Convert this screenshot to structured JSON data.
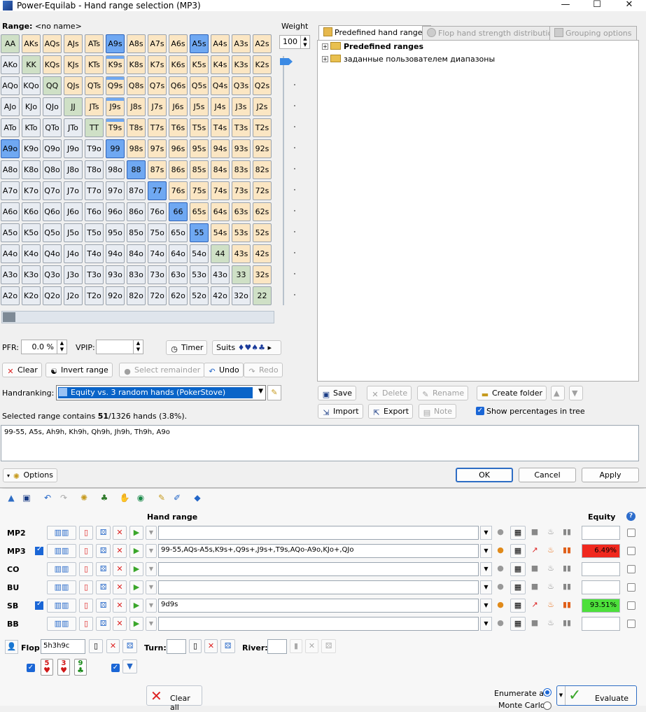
{
  "window": {
    "title": "Power-Equilab - Hand range selection (MP3)"
  },
  "range": {
    "label": "Range:",
    "name": "<no name>"
  },
  "grid": {
    "cells": [
      "AA",
      "AKs",
      "AQs",
      "AJs",
      "ATs",
      "A9s",
      "A8s",
      "A7s",
      "A6s",
      "A5s",
      "A4s",
      "A3s",
      "A2s",
      "AKo",
      "KK",
      "KQs",
      "KJs",
      "KTs",
      "K9s",
      "K8s",
      "K7s",
      "K6s",
      "K5s",
      "K4s",
      "K3s",
      "K2s",
      "AQo",
      "KQo",
      "QQ",
      "QJs",
      "QTs",
      "Q9s",
      "Q8s",
      "Q7s",
      "Q6s",
      "Q5s",
      "Q4s",
      "Q3s",
      "Q2s",
      "AJo",
      "KJo",
      "QJo",
      "JJ",
      "JTs",
      "J9s",
      "J8s",
      "J7s",
      "J6s",
      "J5s",
      "J4s",
      "J3s",
      "J2s",
      "ATo",
      "KTo",
      "QTo",
      "JTo",
      "TT",
      "T9s",
      "T8s",
      "T7s",
      "T6s",
      "T5s",
      "T4s",
      "T3s",
      "T2s",
      "A9o",
      "K9o",
      "Q9o",
      "J9o",
      "T9o",
      "99",
      "98s",
      "97s",
      "96s",
      "95s",
      "94s",
      "93s",
      "92s",
      "A8o",
      "K8o",
      "Q8o",
      "J8o",
      "T8o",
      "98o",
      "88",
      "87s",
      "86s",
      "85s",
      "84s",
      "83s",
      "82s",
      "A7o",
      "K7o",
      "Q7o",
      "J7o",
      "T7o",
      "97o",
      "87o",
      "77",
      "76s",
      "75s",
      "74s",
      "73s",
      "72s",
      "A6o",
      "K6o",
      "Q6o",
      "J6o",
      "T6o",
      "96o",
      "86o",
      "76o",
      "66",
      "65s",
      "64s",
      "63s",
      "62s",
      "A5o",
      "K5o",
      "Q5o",
      "J5o",
      "T5o",
      "95o",
      "85o",
      "75o",
      "65o",
      "55",
      "54s",
      "53s",
      "52s",
      "A4o",
      "K4o",
      "Q4o",
      "J4o",
      "T4o",
      "94o",
      "84o",
      "74o",
      "64o",
      "54o",
      "44",
      "43s",
      "42s",
      "A3o",
      "K3o",
      "Q3o",
      "J3o",
      "T3o",
      "93o",
      "83o",
      "73o",
      "63o",
      "53o",
      "43o",
      "33",
      "32s",
      "A2o",
      "K2o",
      "Q2o",
      "J2o",
      "T2o",
      "92o",
      "82o",
      "72o",
      "62o",
      "52o",
      "42o",
      "32o",
      "22"
    ],
    "selected": [
      "A9s",
      "A5s",
      "99",
      "88",
      "77",
      "66",
      "55",
      "A9o"
    ],
    "partial": [
      "K9s",
      "Q9s",
      "J9s",
      "T9s"
    ]
  },
  "weight": {
    "label": "Weight",
    "value": "100"
  },
  "tabs": [
    {
      "label": "Predefined hand ranges",
      "active": true
    },
    {
      "label": "Flop hand strength distribution",
      "active": false
    },
    {
      "label": "Grouping options",
      "active": false
    }
  ],
  "tree": [
    {
      "label": "Predefined ranges"
    },
    {
      "label": "заданные пользователем диапазоны"
    }
  ],
  "pfr": {
    "label": "PFR:",
    "value": "0.0 %"
  },
  "vpip": {
    "label": "VPIP:",
    "value": ""
  },
  "timer_label": "Timer",
  "suits_label": "Suits",
  "suits_glyphs": "♦♥♠♣",
  "actions": {
    "clear": "Clear",
    "invert": "Invert range",
    "select_remainder": "Select remainder",
    "undo": "Undo",
    "redo": "Redo"
  },
  "tree_actions": {
    "save": "Save",
    "delete": "Delete",
    "rename": "Rename",
    "create_folder": "Create folder",
    "import": "Import",
    "export": "Export",
    "note": "Note",
    "show_pct": "Show percentages in tree"
  },
  "handranking": {
    "label": "Handranking:",
    "value": "Equity vs. 3 random hands (PokerStove)"
  },
  "selection": {
    "prefix": "Selected range contains ",
    "count": "51",
    "suffix": "/1326 hands (3.8%)."
  },
  "range_text": "99-55, A5s, Ah9h, Kh9h, Qh9h, Jh9h, Th9h, A9o",
  "options_label": "Options",
  "dialog_buttons": {
    "ok": "OK",
    "cancel": "Cancel",
    "apply": "Apply"
  },
  "main": {
    "col_hand_range": "Hand range",
    "col_equity": "Equity",
    "players": [
      {
        "name": "MP2",
        "checked": false,
        "range": "",
        "equity": "",
        "eq_style": ""
      },
      {
        "name": "MP3",
        "checked": true,
        "range": "99-55,AQs-A5s,K9s+,Q9s+,J9s+,T9s,AQo-A9o,KJo+,QJo",
        "equity": "6.49%",
        "eq_style": "red"
      },
      {
        "name": "CO",
        "checked": false,
        "range": "",
        "equity": "",
        "eq_style": ""
      },
      {
        "name": "BU",
        "checked": false,
        "range": "",
        "equity": "",
        "eq_style": ""
      },
      {
        "name": "SB",
        "checked": true,
        "range": "9d9s",
        "equity": "93.51%",
        "eq_style": "grn"
      },
      {
        "name": "BB",
        "checked": false,
        "range": "",
        "equity": "",
        "eq_style": ""
      }
    ],
    "board": {
      "flop_label": "Flop:",
      "flop_value": "5h3h9c",
      "turn_label": "Turn:",
      "river_label": "River:",
      "cards": [
        {
          "rank": "5",
          "suit": "♥",
          "color": "#d01818"
        },
        {
          "rank": "3",
          "suit": "♥",
          "color": "#d01818"
        },
        {
          "rank": "9",
          "suit": "♣",
          "color": "#1a8a1a"
        }
      ]
    },
    "clear_all": "Clear all",
    "enumerate_all": "Enumerate all",
    "monte_carlo": "Monte Carlo",
    "evaluate": "Evaluate"
  }
}
